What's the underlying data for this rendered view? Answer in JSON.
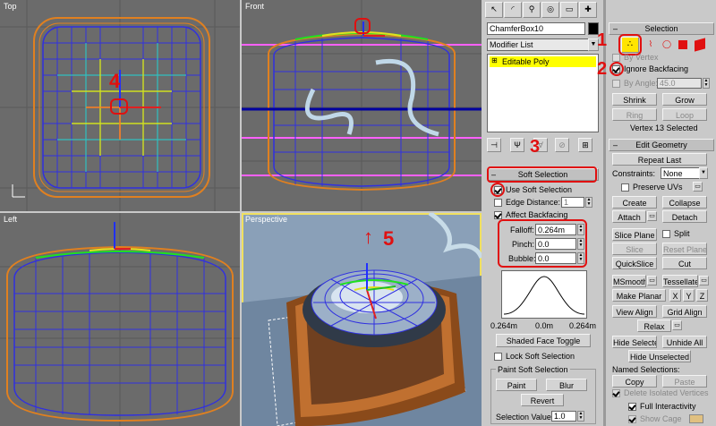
{
  "viewports": {
    "top": "Top",
    "front": "Front",
    "left": "Left",
    "perspective": "Perspective"
  },
  "annotations": {
    "n1": "1",
    "n2": "2",
    "n3": "3",
    "n4": "4",
    "n5": "5"
  },
  "modify_panel": {
    "object_name": "ChamferBox10",
    "modifier_list": "Modifier List",
    "stack_item": "Editable Poly"
  },
  "soft_selection": {
    "title": "Soft Selection",
    "use_soft_selection": "Use Soft Selection",
    "edge_distance": "Edge Distance:",
    "edge_distance_value": "1",
    "affect_backfacing": "Affect Backfacing",
    "falloff_label": "Falloff:",
    "falloff_value": "0.264m",
    "pinch_label": "Pinch:",
    "pinch_value": "0.0",
    "bubble_label": "Bubble:",
    "bubble_value": "0.0",
    "curve_left": "0.264m",
    "curve_mid": "0.0m",
    "curve_right": "0.264m",
    "shaded_face_toggle": "Shaded Face Toggle",
    "lock_soft_selection": "Lock Soft Selection",
    "paint_title": "Paint Soft Selection",
    "paint": "Paint",
    "blur": "Blur",
    "revert": "Revert",
    "selection_value_label": "Selection Value",
    "selection_value": "1.0"
  },
  "selection": {
    "title": "Selection",
    "by_vertex": "By Vertex",
    "ignore_backfacing": "Ignore Backfacing",
    "by_angle": "By Angle:",
    "angle_value": "45.0",
    "shrink": "Shrink",
    "grow": "Grow",
    "ring": "Ring",
    "loop": "Loop",
    "status": "Vertex 13 Selected"
  },
  "edit_geometry": {
    "title": "Edit Geometry",
    "repeat_last": "Repeat Last",
    "constraints_label": "Constraints:",
    "constraints_value": "None",
    "preserve_uvs": "Preserve UVs",
    "create": "Create",
    "collapse": "Collapse",
    "attach": "Attach",
    "detach": "Detach",
    "slice_plane": "Slice Plane",
    "split": "Split",
    "slice": "Slice",
    "reset_plane": "Reset Plane",
    "quickslice": "QuickSlice",
    "cut": "Cut",
    "msmooth": "MSmooth",
    "tessellate": "Tessellate",
    "make_planar": "Make Planar",
    "x": "X",
    "y": "Y",
    "z": "Z",
    "view_align": "View Align",
    "grid_align": "Grid Align",
    "relax": "Relax",
    "hide_selected": "Hide Selected",
    "unhide_all": "Unhide All",
    "hide_unselected": "Hide Unselected",
    "named_selections": "Named Selections:",
    "copy": "Copy",
    "paste": "Paste",
    "delete_isolated": "Delete Isolated Vertices",
    "full_interactivity": "Full Interactivity",
    "show_cage": "Show Cage"
  },
  "colors": {
    "viewport_bg": "#6b6b6b",
    "perspective_bg": "#8aa0b8",
    "annotation_red": "#e01010",
    "stack_highlight": "#ffff00",
    "wire_orange": "#e08020",
    "wire_blue": "#3030e0"
  }
}
